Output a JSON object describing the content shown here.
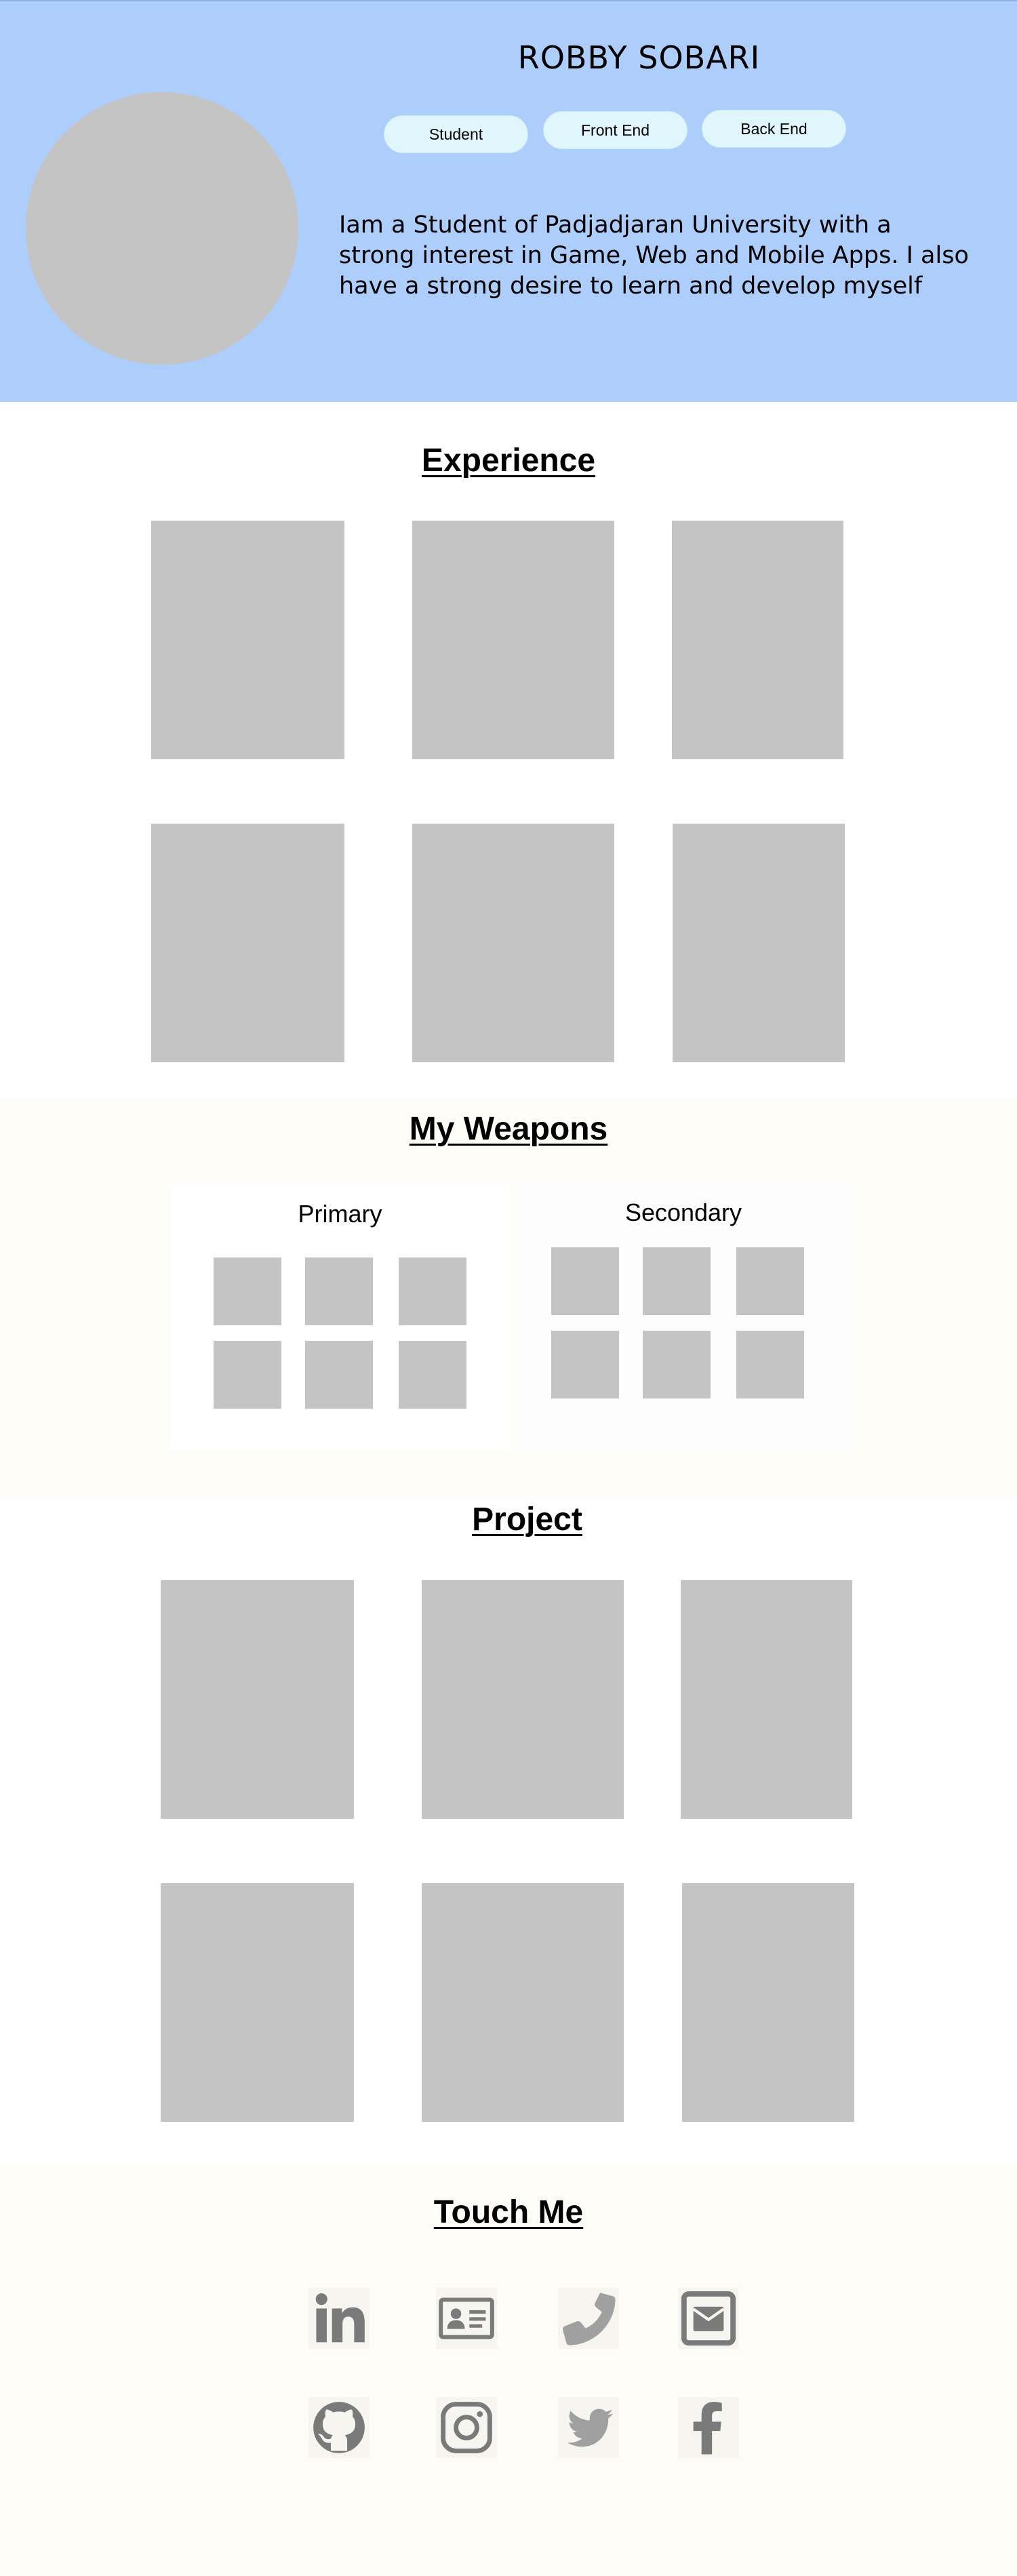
{
  "profile": {
    "name": "ROBBY SOBARI",
    "roles": [
      "Student",
      "Front End",
      "Back End"
    ],
    "bio": "Iam a Student of Padjadjaran University with a strong interest in Game, Web and Mobile Apps. I also have a strong desire to learn and develop myself"
  },
  "experience": {
    "title": "Experience"
  },
  "weapons": {
    "title": "My Weapons",
    "primary_title": "Primary",
    "secondary_title": "Secondary"
  },
  "project": {
    "title": "Project"
  },
  "contact": {
    "title": "Touch Me",
    "icons": [
      "linkedin-icon",
      "id-card-icon",
      "phone-icon",
      "envelope-icon",
      "github-icon",
      "instagram-icon",
      "twitter-icon",
      "facebook-icon"
    ]
  },
  "colors": {
    "hero_bg": "#adcdfb",
    "pill_bg": "#dff6fd",
    "placeholder": "#c4c4c4",
    "section_cream": "#fffdf8",
    "icon_gray": "#7a7a7a"
  }
}
